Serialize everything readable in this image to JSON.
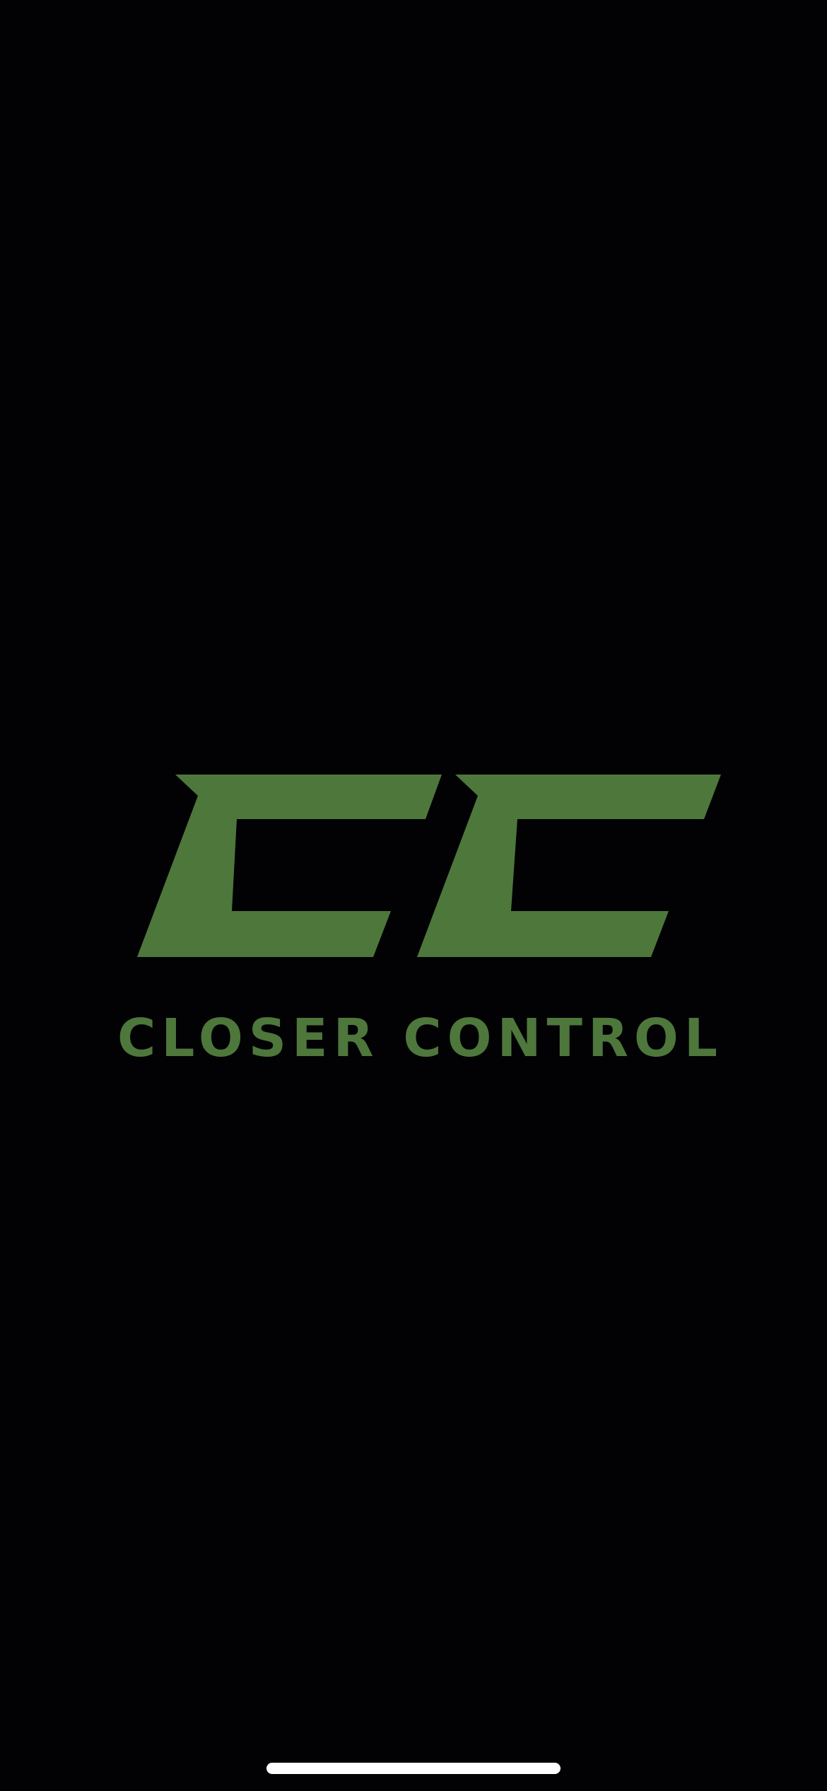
{
  "screen": {
    "type": "splash",
    "background_color": "#020104"
  },
  "logo": {
    "monogram": "CC",
    "wordmark": "CLOSER CONTROL",
    "brand_color": "#4E773C"
  },
  "system": {
    "home_indicator_color": "#FFFFFF"
  }
}
